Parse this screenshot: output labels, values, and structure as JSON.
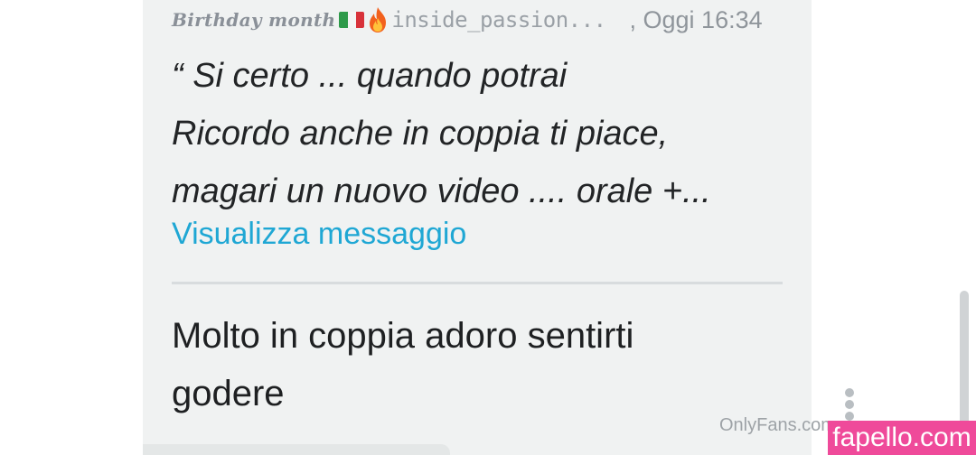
{
  "quote": {
    "sender_name": "Birthday month",
    "flag_icon": "italy-flag-icon",
    "emoji_icon": "fire-icon",
    "sender_handle": "inside_passion...",
    "timestamp": ", Oggi 16:34",
    "lines": [
      "“ Si certo ... quando potrai",
      "Ricordo anche in coppia ti piace,",
      "magari un nuovo video .... orale +..."
    ],
    "view_link": "Visualizza messaggio"
  },
  "reply": {
    "lines": [
      "Molto in coppia adoro sentirti",
      "godere"
    ]
  },
  "menu": {
    "icon": "more-vertical-icon"
  },
  "watermarks": {
    "onlyfans": "OnlyFans.com",
    "fapello": "fapello.com"
  },
  "colors": {
    "bubble": "#f0f2f2",
    "link": "#1fa7d4",
    "badge": "#ef4a9a"
  }
}
